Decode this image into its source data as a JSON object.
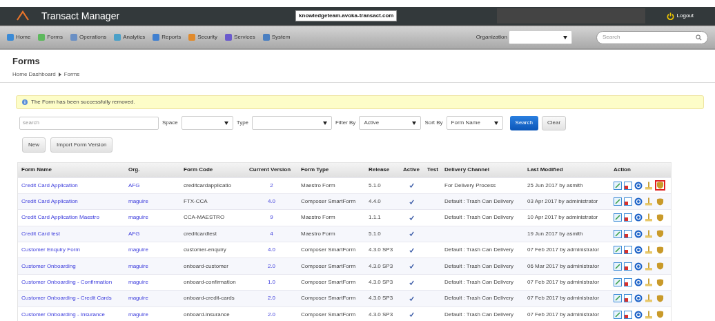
{
  "header": {
    "title": "Transact Manager",
    "host": "knowledgeteam.avoka-transact.com",
    "logout": "Logout"
  },
  "nav": {
    "items": [
      {
        "label": "Home",
        "color": "#3a8ad6"
      },
      {
        "label": "Forms",
        "color": "#5cb85c"
      },
      {
        "label": "Operations",
        "color": "#6a8fc4"
      },
      {
        "label": "Analytics",
        "color": "#4aa0c8"
      },
      {
        "label": "Reports",
        "color": "#3f7fd0"
      },
      {
        "label": "Security",
        "color": "#e08a2c"
      },
      {
        "label": "Services",
        "color": "#6a5acd"
      },
      {
        "label": "System",
        "color": "#4a7fc1"
      }
    ],
    "organization_label": "Organization",
    "search_placeholder": "Search"
  },
  "page": {
    "title": "Forms",
    "breadcrumb": [
      "Home Dashboard",
      "Forms"
    ]
  },
  "alert": "The Form has been successfully removed.",
  "filters": {
    "search_placeholder": "search",
    "space_label": "Space",
    "type_label": "Type",
    "filter_by_label": "Filter By",
    "filter_by_value": "Active",
    "sort_by_label": "Sort By",
    "sort_by_value": "Form Name",
    "search_button": "Search",
    "clear_button": "Clear"
  },
  "buttons": [
    "New",
    "Import Form Version"
  ],
  "table": {
    "columns": [
      "Form Name",
      "Org.",
      "Form Code",
      "Current Version",
      "Form Type",
      "Release",
      "Active",
      "Test",
      "Delivery Channel",
      "Last Modified",
      "Action"
    ],
    "rows": [
      {
        "name": "Credit Card Application",
        "org": "AFG",
        "code": "creditcardapplicatio",
        "version": "2",
        "type": "Maestro Form",
        "release": "5.1.0",
        "active": true,
        "channel": "For Delivery Process",
        "modified": "25 Jun 2017 by asmith",
        "highlighted": true
      },
      {
        "name": "Credit Card Application",
        "org": "maguire",
        "code": "FTX-CCA",
        "version": "4.0",
        "type": "Composer SmartForm",
        "release": "4.4.0",
        "active": true,
        "channel": "Default : Trash Can Delivery",
        "modified": "03 Apr 2017 by administrator",
        "highlighted": false
      },
      {
        "name": "Credit Card Application Maestro",
        "org": "maguire",
        "code": "CCA-MAESTRO",
        "version": "9",
        "type": "Maestro Form",
        "release": "1.1.1",
        "active": true,
        "channel": "Default : Trash Can Delivery",
        "modified": "10 Apr 2017 by administrator",
        "highlighted": false
      },
      {
        "name": "Credit Card test",
        "org": "AFG",
        "code": "creditcardtest",
        "version": "4",
        "type": "Maestro Form",
        "release": "5.1.0",
        "active": true,
        "modified": "19 Jun 2017 by asmith",
        "highlighted": false
      },
      {
        "name": "Customer Enquiry Form",
        "org": "maguire",
        "code": "customer-enquiry",
        "version": "4.0",
        "type": "Composer SmartForm",
        "release": "4.3.0 SP3",
        "active": true,
        "channel": "Default : Trash Can Delivery",
        "modified": "07 Feb 2017 by administrator",
        "highlighted": false
      },
      {
        "name": "Customer Onboarding",
        "org": "maguire",
        "code": "onboard-customer",
        "version": "2.0",
        "type": "Composer SmartForm",
        "release": "4.3.0 SP3",
        "active": true,
        "channel": "Default : Trash Can Delivery",
        "modified": "06 Mar 2017 by administrator",
        "highlighted": false
      },
      {
        "name": "Customer Onboarding - Confirmation",
        "org": "maguire",
        "code": "onboard-confirmation",
        "version": "1.0",
        "type": "Composer SmartForm",
        "release": "4.3.0 SP3",
        "active": true,
        "channel": "Default : Trash Can Delivery",
        "modified": "07 Feb 2017 by administrator",
        "highlighted": false
      },
      {
        "name": "Customer Onboarding - Credit Cards",
        "org": "maguire",
        "code": "onboard-credit-cards",
        "version": "2.0",
        "type": "Composer SmartForm",
        "release": "4.3.0 SP3",
        "active": true,
        "channel": "Default : Trash Can Delivery",
        "modified": "07 Feb 2017 by administrator",
        "highlighted": false
      },
      {
        "name": "Customer Onboarding - Insurance",
        "org": "maguire",
        "code": "onboard-insurance",
        "version": "2.0",
        "type": "Composer SmartForm",
        "release": "4.3.0 SP3",
        "active": true,
        "channel": "Default : Trash Can Delivery",
        "modified": "07 Feb 2017 by administrator",
        "highlighted": false
      }
    ]
  }
}
